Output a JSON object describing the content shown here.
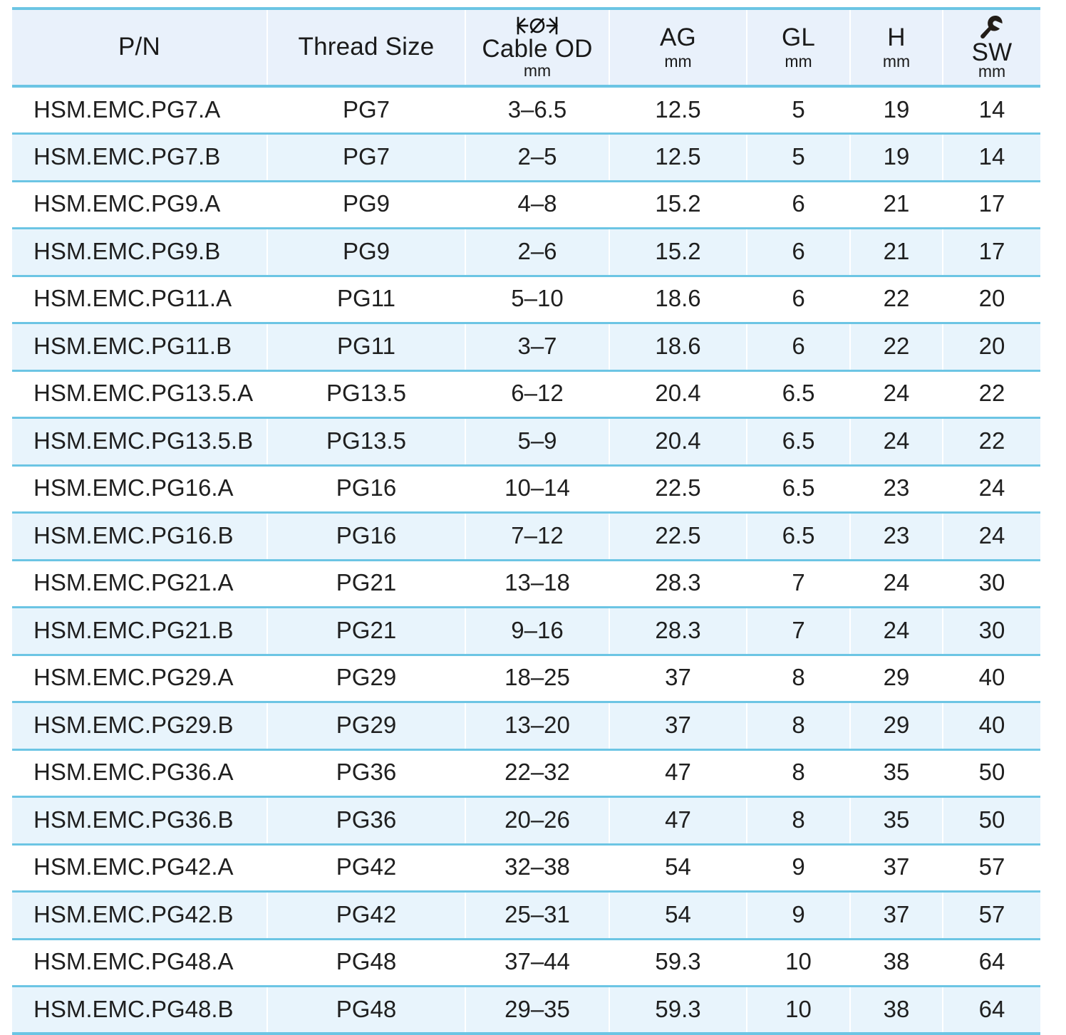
{
  "table": {
    "columns": [
      {
        "key": "pn",
        "label": "P/N",
        "unit": "",
        "symbol": ""
      },
      {
        "key": "thread",
        "label": "Thread Size",
        "unit": "",
        "symbol": ""
      },
      {
        "key": "od",
        "label": "Cable OD",
        "unit": "mm",
        "symbol": "diameter-dimension-icon"
      },
      {
        "key": "ag",
        "label": "AG",
        "unit": "mm",
        "symbol": ""
      },
      {
        "key": "gl",
        "label": "GL",
        "unit": "mm",
        "symbol": ""
      },
      {
        "key": "h",
        "label": "H",
        "unit": "mm",
        "symbol": ""
      },
      {
        "key": "sw",
        "label": "SW",
        "unit": "mm",
        "symbol": "wrench-icon"
      }
    ],
    "rows": [
      {
        "pn": "HSM.EMC.PG7.A",
        "thread": "PG7",
        "od": "3–6.5",
        "ag": "12.5",
        "gl": "5",
        "h": "19",
        "sw": "14"
      },
      {
        "pn": "HSM.EMC.PG7.B",
        "thread": "PG7",
        "od": "2–5",
        "ag": "12.5",
        "gl": "5",
        "h": "19",
        "sw": "14"
      },
      {
        "pn": "HSM.EMC.PG9.A",
        "thread": "PG9",
        "od": "4–8",
        "ag": "15.2",
        "gl": "6",
        "h": "21",
        "sw": "17"
      },
      {
        "pn": "HSM.EMC.PG9.B",
        "thread": "PG9",
        "od": "2–6",
        "ag": "15.2",
        "gl": "6",
        "h": "21",
        "sw": "17"
      },
      {
        "pn": "HSM.EMC.PG11.A",
        "thread": "PG11",
        "od": "5–10",
        "ag": "18.6",
        "gl": "6",
        "h": "22",
        "sw": "20"
      },
      {
        "pn": "HSM.EMC.PG11.B",
        "thread": "PG11",
        "od": "3–7",
        "ag": "18.6",
        "gl": "6",
        "h": "22",
        "sw": "20"
      },
      {
        "pn": "HSM.EMC.PG13.5.A",
        "thread": "PG13.5",
        "od": "6–12",
        "ag": "20.4",
        "gl": "6.5",
        "h": "24",
        "sw": "22"
      },
      {
        "pn": "HSM.EMC.PG13.5.B",
        "thread": "PG13.5",
        "od": "5–9",
        "ag": "20.4",
        "gl": "6.5",
        "h": "24",
        "sw": "22"
      },
      {
        "pn": "HSM.EMC.PG16.A",
        "thread": "PG16",
        "od": "10–14",
        "ag": "22.5",
        "gl": "6.5",
        "h": "23",
        "sw": "24"
      },
      {
        "pn": "HSM.EMC.PG16.B",
        "thread": "PG16",
        "od": "7–12",
        "ag": "22.5",
        "gl": "6.5",
        "h": "23",
        "sw": "24"
      },
      {
        "pn": "HSM.EMC.PG21.A",
        "thread": "PG21",
        "od": "13–18",
        "ag": "28.3",
        "gl": "7",
        "h": "24",
        "sw": "30"
      },
      {
        "pn": "HSM.EMC.PG21.B",
        "thread": "PG21",
        "od": "9–16",
        "ag": "28.3",
        "gl": "7",
        "h": "24",
        "sw": "30"
      },
      {
        "pn": "HSM.EMC.PG29.A",
        "thread": "PG29",
        "od": "18–25",
        "ag": "37",
        "gl": "8",
        "h": "29",
        "sw": "40"
      },
      {
        "pn": "HSM.EMC.PG29.B",
        "thread": "PG29",
        "od": "13–20",
        "ag": "37",
        "gl": "8",
        "h": "29",
        "sw": "40"
      },
      {
        "pn": "HSM.EMC.PG36.A",
        "thread": "PG36",
        "od": "22–32",
        "ag": "47",
        "gl": "8",
        "h": "35",
        "sw": "50"
      },
      {
        "pn": "HSM.EMC.PG36.B",
        "thread": "PG36",
        "od": "20–26",
        "ag": "47",
        "gl": "8",
        "h": "35",
        "sw": "50"
      },
      {
        "pn": "HSM.EMC.PG42.A",
        "thread": "PG42",
        "od": "32–38",
        "ag": "54",
        "gl": "9",
        "h": "37",
        "sw": "57"
      },
      {
        "pn": "HSM.EMC.PG42.B",
        "thread": "PG42",
        "od": "25–31",
        "ag": "54",
        "gl": "9",
        "h": "37",
        "sw": "57"
      },
      {
        "pn": "HSM.EMC.PG48.A",
        "thread": "PG48",
        "od": "37–44",
        "ag": "59.3",
        "gl": "10",
        "h": "38",
        "sw": "64"
      },
      {
        "pn": "HSM.EMC.PG48.B",
        "thread": "PG48",
        "od": "29–35",
        "ag": "59.3",
        "gl": "10",
        "h": "38",
        "sw": "64"
      }
    ]
  },
  "colors": {
    "rule": "#6cc5e4",
    "header_bg": "#e9f1fb",
    "row_alt_bg": "#e8f4fc",
    "row_bg": "#ffffff",
    "text": "#1f1f1f"
  }
}
